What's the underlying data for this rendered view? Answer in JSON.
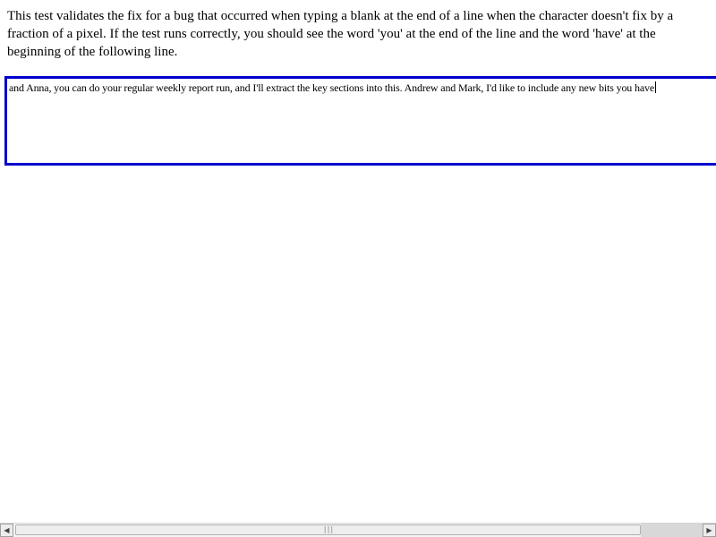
{
  "description": {
    "text": "This test validates the fix for a bug that occurred when typing a blank at the end of a line when the character doesn't fix by a fraction of a pixel. If the test runs correctly, you should see the word 'you' at the end of the line and the word 'have' at the beginning of the following line."
  },
  "editor": {
    "text": "and Anna, you can do your regular weekly report run, and I'll extract the key sections into this. Andrew and Mark, I'd like to include any new bits you have",
    "border_color": "#0000cc"
  },
  "scrollbar": {
    "left_arrow": "◀",
    "right_arrow": "▶",
    "grip": "|||"
  }
}
